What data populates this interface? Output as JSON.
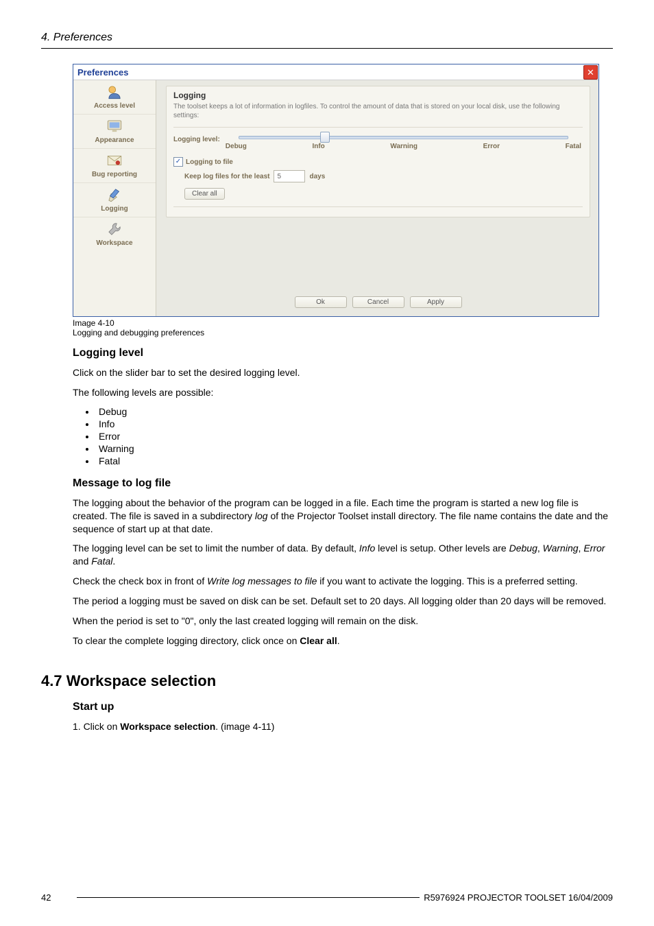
{
  "header": {
    "chapter": "4.  Preferences"
  },
  "screenshot": {
    "window_title": "Preferences",
    "close_glyph": "✕",
    "sidebar": {
      "items": [
        {
          "label": "Access level"
        },
        {
          "label": "Appearance"
        },
        {
          "label": "Bug reporting"
        },
        {
          "label": "Logging"
        },
        {
          "label": "Workspace"
        }
      ]
    },
    "logging_card": {
      "title": "Logging",
      "desc": "The toolset keeps a lot of information in logfiles. To control the amount of data that is stored on your local disk, use the following settings:",
      "level_label": "Logging level:",
      "ticks": [
        "Debug",
        "Info",
        "Warning",
        "Error",
        "Fatal"
      ],
      "to_file_label": "Logging to file",
      "keep_prefix": "Keep log files for the least",
      "keep_value": "5",
      "keep_suffix": "days",
      "clear_all": "Clear all"
    },
    "buttons": {
      "ok": "Ok",
      "cancel": "Cancel",
      "apply": "Apply"
    }
  },
  "caption": {
    "num": "Image 4-10",
    "txt": "Logging and debugging preferences"
  },
  "logging_level": {
    "heading": "Logging level",
    "p1": "Click on the slider bar to set the desired logging level.",
    "p2": "The following levels are possible:",
    "items": [
      "Debug",
      "Info",
      "Error",
      "Warning",
      "Fatal"
    ]
  },
  "msg_to_file": {
    "heading": "Message to log file",
    "p1_a": "The logging about the behavior of the program can be logged in a file. Each time the program is started a new log file is created. The file is saved in a subdirectory ",
    "p1_i": "log",
    "p1_b": " of the Projector Toolset install directory. The file name contains the date and the sequence of start up at that date.",
    "p2_a": "The logging level can be set to limit the number of data. By default, ",
    "p2_i1": "Info",
    "p2_b": " level is setup. Other levels are ",
    "p2_i2": "Debug",
    "p2_c": ", ",
    "p2_i3": "Warning",
    "p2_d": ", ",
    "p2_i4": "Error",
    "p2_e": " and ",
    "p2_i5": "Fatal",
    "p2_f": ".",
    "p3_a": "Check the check box in front of ",
    "p3_i": "Write log messages to file",
    "p3_b": " if you want to activate the logging. This is a preferred setting.",
    "p4": "The period a logging must be saved on disk can be set. Default set to 20 days. All logging older than 20 days will be removed.",
    "p5": "When the period is set to \"0\", only the last created logging will remain on the disk.",
    "p6_a": "To clear the complete logging directory, click once on ",
    "p6_b": "Clear all",
    "p6_c": "."
  },
  "workspace": {
    "heading": "4.7    Workspace selection",
    "sub": "Start up",
    "step_a": "1. Click on ",
    "step_b": "Workspace selection",
    "step_c": ".  (image 4-11)"
  },
  "footer": {
    "page": "42",
    "rev": "R5976924   PROJECTOR TOOLSET  16/04/2009"
  }
}
